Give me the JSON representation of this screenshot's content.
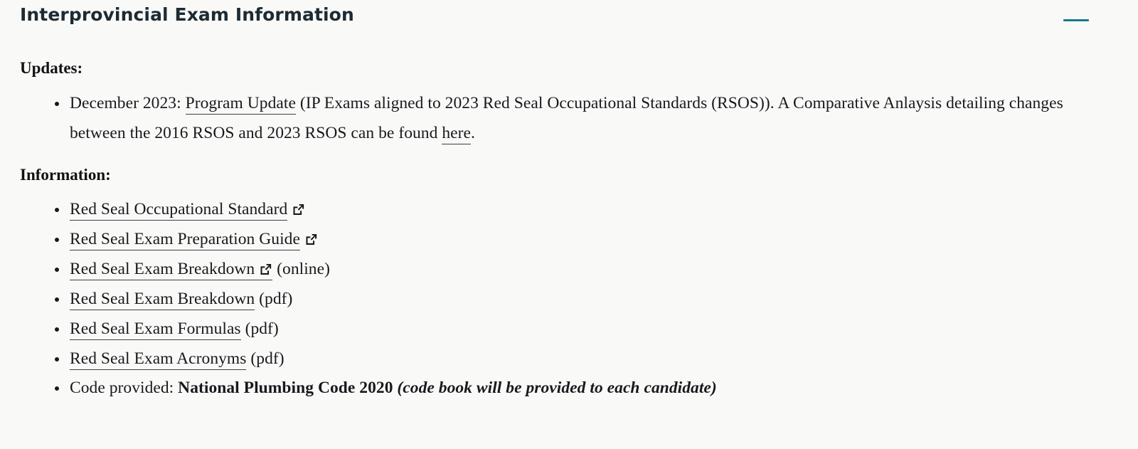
{
  "panel": {
    "title": "Interprovincial Exam Information",
    "collapse_icon": "minus-icon",
    "collapse_color": "#18798b",
    "background_color": "#f9faf8",
    "title_color": "#1d2b33"
  },
  "updates": {
    "heading": "Updates:",
    "items": [
      {
        "lead": "December 2023: ",
        "link_text": "Program Update",
        "middle": " (IP Exams aligned to 2023 Red Seal Occupational Standards (RSOS)). A Comparative Anlaysis detailing changes between the 2016 RSOS and 2023 RSOS can be found ",
        "link2_text": "here",
        "tail": "."
      }
    ]
  },
  "information": {
    "heading": "Information:",
    "items": [
      {
        "link_text": "Red Seal Occupational Standard",
        "external_icon": "external-link-icon",
        "icon_inside_link": false,
        "suffix": ""
      },
      {
        "link_text": "Red Seal Exam Preparation Guide",
        "external_icon": "external-link-icon",
        "icon_inside_link": false,
        "suffix": ""
      },
      {
        "link_text": "Red Seal Exam Breakdown",
        "external_icon": "external-link-icon",
        "icon_inside_link": true,
        "suffix": " (online)"
      },
      {
        "link_text": "Red Seal Exam Breakdown",
        "external_icon": "",
        "icon_inside_link": false,
        "suffix": " (pdf)"
      },
      {
        "link_text": "Red Seal Exam Formulas",
        "external_icon": "",
        "icon_inside_link": false,
        "suffix": " (pdf)"
      },
      {
        "link_text": "Red Seal Exam Acronyms",
        "external_icon": "",
        "icon_inside_link": false,
        "suffix": " (pdf)"
      }
    ],
    "code_item": {
      "lead": "Code provided: ",
      "code_name": "National Plumbing Code 2020",
      "note": " (code book will be provided to each candidate)"
    }
  }
}
